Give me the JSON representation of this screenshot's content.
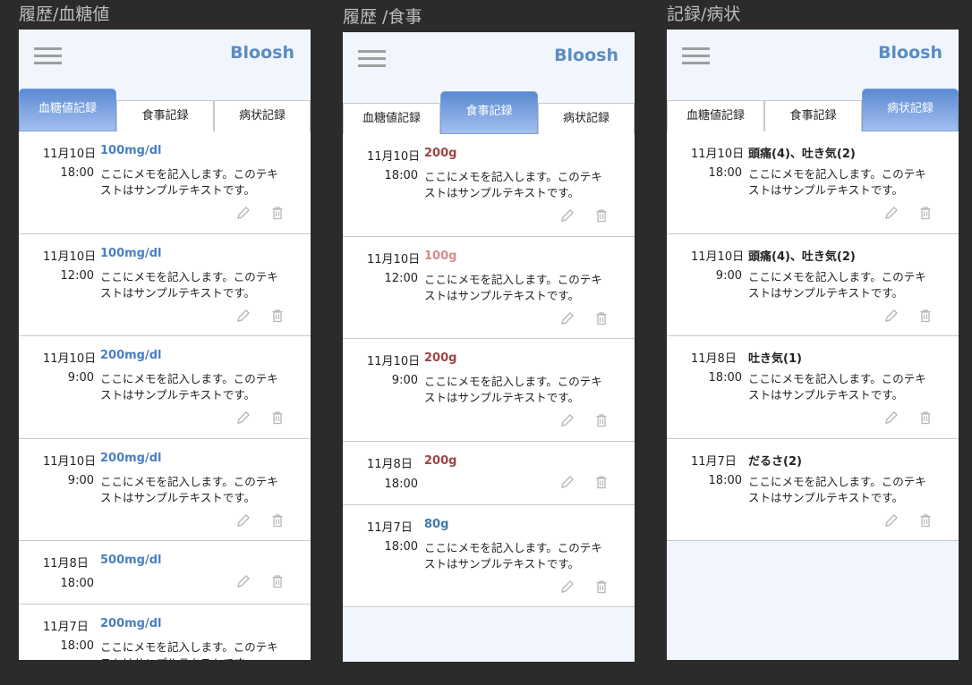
{
  "frames": [
    {
      "title": "履歴/血糖値",
      "brand": "Bloosh",
      "active_tab": 0,
      "tabs": [
        "血糖値記録",
        "食事記録",
        "病状記録"
      ],
      "entries": [
        {
          "date": "11月10日",
          "value": "100mg/dl",
          "value_color": "#4a7fc1",
          "time": "18:00",
          "memo": "ここにメモを記入します。このテキストはサンプルテキストです。"
        },
        {
          "date": "11月10日",
          "value": "100mg/dl",
          "value_color": "#4a7fc1",
          "time": "12:00",
          "memo": "ここにメモを記入します。このテキストはサンプルテキストです。"
        },
        {
          "date": "11月10日",
          "value": "200mg/dl",
          "value_color": "#4a7fc1",
          "time": "9:00",
          "memo": "ここにメモを記入します。このテキストはサンプルテキストです。"
        },
        {
          "date": "11月10日",
          "value": "200mg/dl",
          "value_color": "#4a7fc1",
          "time": "9:00",
          "memo": "ここにメモを記入します。このテキストはサンプルテキストです。"
        },
        {
          "date": "11月8日",
          "value": "500mg/dl",
          "value_color": "#4a7fc1",
          "time": "18:00",
          "memo": ""
        },
        {
          "date": "11月7日",
          "value": "200mg/dl",
          "value_color": "#4a7fc1",
          "time": "18:00",
          "memo": "ここにメモを記入します。このテキストはサンプルテキストです。"
        }
      ]
    },
    {
      "title": "履歴 /食事",
      "brand": "Bloosh",
      "active_tab": 1,
      "tabs": [
        "血糖値記録",
        "食事記録",
        "病状記録"
      ],
      "entries": [
        {
          "date": "11月10日",
          "value": "200g",
          "value_color": "#9c4545",
          "time": "18:00",
          "memo": "ここにメモを記入します。このテキストはサンプルテキストです。"
        },
        {
          "date": "11月10日",
          "value": "100g",
          "value_color": "#d98a8a",
          "time": "12:00",
          "memo": "ここにメモを記入します。このテキストはサンプルテキストです。"
        },
        {
          "date": "11月10日",
          "value": "200g",
          "value_color": "#9c4545",
          "time": "9:00",
          "memo": "ここにメモを記入します。このテキストはサンプルテキストです。"
        },
        {
          "date": "11月8日",
          "value": "200g",
          "value_color": "#9c4545",
          "time": "18:00",
          "memo": ""
        },
        {
          "date": "11月7日",
          "value": "80g",
          "value_color": "#3f78b0",
          "time": "18:00",
          "memo": "ここにメモを記入します。このテキストはサンプルテキストです。"
        }
      ]
    },
    {
      "title": "記録/病状",
      "brand": "Bloosh",
      "active_tab": 2,
      "tabs": [
        "血糖値記録",
        "食事記録",
        "病状記録"
      ],
      "entries": [
        {
          "date": "11月10日",
          "value": "頭痛(4)、吐き気(2)",
          "value_color": "#222222",
          "time": "18:00",
          "memo": "ここにメモを記入します。このテキストはサンプルテキストです。"
        },
        {
          "date": "11月10日",
          "value": "頭痛(4)、吐き気(2)",
          "value_color": "#222222",
          "time": "9:00",
          "memo": "ここにメモを記入します。このテキストはサンプルテキストです。"
        },
        {
          "date": "11月8日",
          "value": "吐き気(1)",
          "value_color": "#222222",
          "time": "18:00",
          "memo": "ここにメモを記入します。このテキストはサンプルテキストです。"
        },
        {
          "date": "11月7日",
          "value": "だるさ(2)",
          "value_color": "#222222",
          "time": "18:00",
          "memo": "ここにメモを記入します。このテキストはサンプルテキストです。"
        }
      ]
    }
  ],
  "icons": {
    "menu": "hamburger-icon",
    "edit": "pencil-icon",
    "delete": "trash-icon"
  },
  "colors": {
    "accent": "#5b8cc4",
    "tab_active_top": "#5a8ad2",
    "tab_active_bottom": "#a3bff0",
    "icon_gray": "#b8b8b8"
  }
}
